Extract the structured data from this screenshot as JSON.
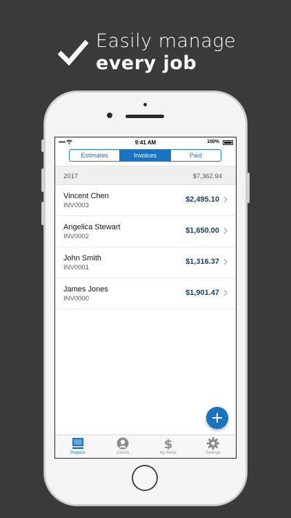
{
  "promo": {
    "line1": "Easily manage",
    "line2": "every job"
  },
  "status_bar": {
    "signal": "•••••",
    "time": "9:41 AM",
    "battery": "100%"
  },
  "tabs": [
    {
      "label": "Estimates",
      "active": false
    },
    {
      "label": "Invoices",
      "active": true
    },
    {
      "label": "Paid",
      "active": false
    }
  ],
  "year_section": {
    "year": "2017",
    "total": "$7,362.94"
  },
  "invoices": [
    {
      "name": "Vincent Chen",
      "number": "INV0003",
      "amount": "$2,495.10"
    },
    {
      "name": "Angelica Stewart",
      "number": "INV0002",
      "amount": "$1,650.00"
    },
    {
      "name": "John Smith",
      "number": "INV0001",
      "amount": "$1,316.37"
    },
    {
      "name": "James Jones",
      "number": "INV0000",
      "amount": "$1,901.47"
    }
  ],
  "tab_bar": [
    {
      "label": "Projects",
      "icon": "projects-icon",
      "active": true
    },
    {
      "label": "Clients",
      "icon": "clients-icon",
      "active": false
    },
    {
      "label": "My Items",
      "icon": "dollar-icon",
      "active": false
    },
    {
      "label": "Settings",
      "icon": "gear-icon",
      "active": false
    }
  ],
  "colors": {
    "accent": "#1a73c0",
    "amount": "#1a3c6e",
    "background": "#3a3a3a"
  }
}
